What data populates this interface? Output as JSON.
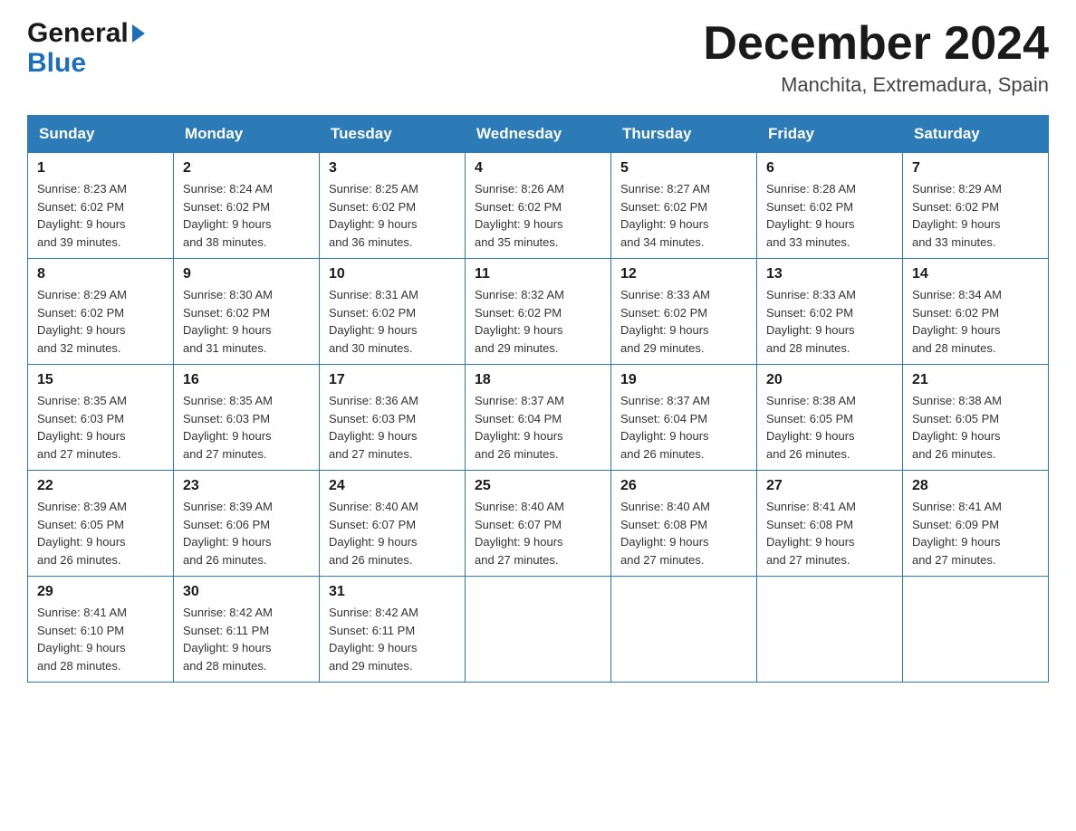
{
  "logo": {
    "line1": "General",
    "line2": "Blue"
  },
  "title": {
    "month": "December 2024",
    "location": "Manchita, Extremadura, Spain"
  },
  "weekdays": [
    "Sunday",
    "Monday",
    "Tuesday",
    "Wednesday",
    "Thursday",
    "Friday",
    "Saturday"
  ],
  "weeks": [
    [
      {
        "day": "1",
        "sunrise": "8:23 AM",
        "sunset": "6:02 PM",
        "daylight": "9 hours and 39 minutes."
      },
      {
        "day": "2",
        "sunrise": "8:24 AM",
        "sunset": "6:02 PM",
        "daylight": "9 hours and 38 minutes."
      },
      {
        "day": "3",
        "sunrise": "8:25 AM",
        "sunset": "6:02 PM",
        "daylight": "9 hours and 36 minutes."
      },
      {
        "day": "4",
        "sunrise": "8:26 AM",
        "sunset": "6:02 PM",
        "daylight": "9 hours and 35 minutes."
      },
      {
        "day": "5",
        "sunrise": "8:27 AM",
        "sunset": "6:02 PM",
        "daylight": "9 hours and 34 minutes."
      },
      {
        "day": "6",
        "sunrise": "8:28 AM",
        "sunset": "6:02 PM",
        "daylight": "9 hours and 33 minutes."
      },
      {
        "day": "7",
        "sunrise": "8:29 AM",
        "sunset": "6:02 PM",
        "daylight": "9 hours and 33 minutes."
      }
    ],
    [
      {
        "day": "8",
        "sunrise": "8:29 AM",
        "sunset": "6:02 PM",
        "daylight": "9 hours and 32 minutes."
      },
      {
        "day": "9",
        "sunrise": "8:30 AM",
        "sunset": "6:02 PM",
        "daylight": "9 hours and 31 minutes."
      },
      {
        "day": "10",
        "sunrise": "8:31 AM",
        "sunset": "6:02 PM",
        "daylight": "9 hours and 30 minutes."
      },
      {
        "day": "11",
        "sunrise": "8:32 AM",
        "sunset": "6:02 PM",
        "daylight": "9 hours and 29 minutes."
      },
      {
        "day": "12",
        "sunrise": "8:33 AM",
        "sunset": "6:02 PM",
        "daylight": "9 hours and 29 minutes."
      },
      {
        "day": "13",
        "sunrise": "8:33 AM",
        "sunset": "6:02 PM",
        "daylight": "9 hours and 28 minutes."
      },
      {
        "day": "14",
        "sunrise": "8:34 AM",
        "sunset": "6:02 PM",
        "daylight": "9 hours and 28 minutes."
      }
    ],
    [
      {
        "day": "15",
        "sunrise": "8:35 AM",
        "sunset": "6:03 PM",
        "daylight": "9 hours and 27 minutes."
      },
      {
        "day": "16",
        "sunrise": "8:35 AM",
        "sunset": "6:03 PM",
        "daylight": "9 hours and 27 minutes."
      },
      {
        "day": "17",
        "sunrise": "8:36 AM",
        "sunset": "6:03 PM",
        "daylight": "9 hours and 27 minutes."
      },
      {
        "day": "18",
        "sunrise": "8:37 AM",
        "sunset": "6:04 PM",
        "daylight": "9 hours and 26 minutes."
      },
      {
        "day": "19",
        "sunrise": "8:37 AM",
        "sunset": "6:04 PM",
        "daylight": "9 hours and 26 minutes."
      },
      {
        "day": "20",
        "sunrise": "8:38 AM",
        "sunset": "6:05 PM",
        "daylight": "9 hours and 26 minutes."
      },
      {
        "day": "21",
        "sunrise": "8:38 AM",
        "sunset": "6:05 PM",
        "daylight": "9 hours and 26 minutes."
      }
    ],
    [
      {
        "day": "22",
        "sunrise": "8:39 AM",
        "sunset": "6:05 PM",
        "daylight": "9 hours and 26 minutes."
      },
      {
        "day": "23",
        "sunrise": "8:39 AM",
        "sunset": "6:06 PM",
        "daylight": "9 hours and 26 minutes."
      },
      {
        "day": "24",
        "sunrise": "8:40 AM",
        "sunset": "6:07 PM",
        "daylight": "9 hours and 26 minutes."
      },
      {
        "day": "25",
        "sunrise": "8:40 AM",
        "sunset": "6:07 PM",
        "daylight": "9 hours and 27 minutes."
      },
      {
        "day": "26",
        "sunrise": "8:40 AM",
        "sunset": "6:08 PM",
        "daylight": "9 hours and 27 minutes."
      },
      {
        "day": "27",
        "sunrise": "8:41 AM",
        "sunset": "6:08 PM",
        "daylight": "9 hours and 27 minutes."
      },
      {
        "day": "28",
        "sunrise": "8:41 AM",
        "sunset": "6:09 PM",
        "daylight": "9 hours and 27 minutes."
      }
    ],
    [
      {
        "day": "29",
        "sunrise": "8:41 AM",
        "sunset": "6:10 PM",
        "daylight": "9 hours and 28 minutes."
      },
      {
        "day": "30",
        "sunrise": "8:42 AM",
        "sunset": "6:11 PM",
        "daylight": "9 hours and 28 minutes."
      },
      {
        "day": "31",
        "sunrise": "8:42 AM",
        "sunset": "6:11 PM",
        "daylight": "9 hours and 29 minutes."
      },
      null,
      null,
      null,
      null
    ]
  ],
  "labels": {
    "sunrise": "Sunrise:",
    "sunset": "Sunset:",
    "daylight": "Daylight:"
  }
}
